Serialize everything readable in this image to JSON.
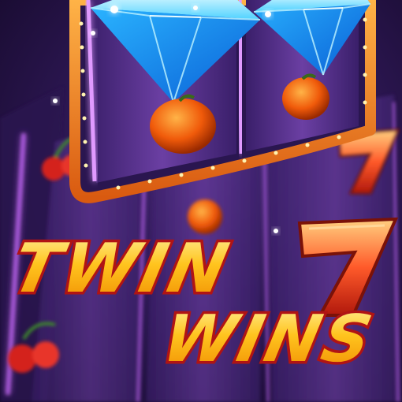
{
  "game": {
    "title_line1": "TWIN",
    "title_line2": "WINS"
  },
  "reels": {
    "front": [
      {
        "symbol": "diamond-icon"
      },
      {
        "symbol": "diamond-icon"
      }
    ],
    "front_lower": [
      {
        "symbol": "orange-fruit-icon"
      },
      {
        "symbol": "orange-fruit-icon"
      }
    ],
    "back": [
      {
        "symbol": "cherry-icon"
      },
      {
        "symbol": "seven-icon"
      },
      {
        "symbol": "seven-icon"
      },
      {
        "symbol": "cherry-icon"
      }
    ]
  },
  "colors": {
    "background": "#2a1650",
    "neon_purple": "#c86bff",
    "frame_orange": "#ff8a1c",
    "frame_gold": "#ffd54a",
    "diamond_blue": "#37c6ff",
    "seven_red": "#ff4a2a",
    "title_fill": "#ffd23a",
    "title_outline": "#c01818"
  }
}
